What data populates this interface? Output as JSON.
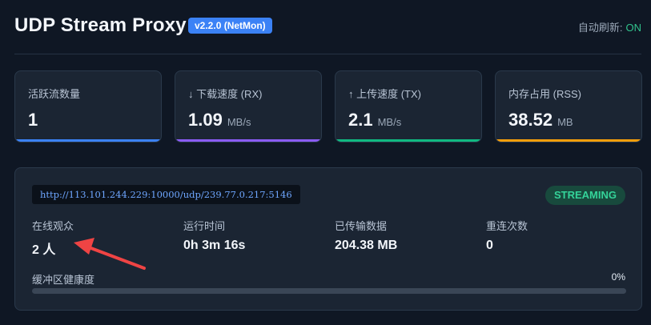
{
  "header": {
    "title": "UDP Stream Proxy",
    "version": "v2.2.0 (NetMon)",
    "auto_refresh_label": "自动刷新:",
    "auto_refresh_value": "ON"
  },
  "metrics": [
    {
      "label": "活跃流数量",
      "value": "1",
      "unit": "",
      "accent_color": "#3b82f6"
    },
    {
      "label": "↓ 下载速度 (RX)",
      "value": "1.09",
      "unit": "MB/s",
      "accent_color": "#8b5cf6"
    },
    {
      "label": "↑ 上传速度 (TX)",
      "value": "2.1",
      "unit": "MB/s",
      "accent_color": "#10b981"
    },
    {
      "label": "内存占用 (RSS)",
      "value": "38.52",
      "unit": "MB",
      "accent_color": "#f59e0b"
    }
  ],
  "stream": {
    "url": "http://113.101.244.229:10000/udp/239.77.0.217:5146",
    "status": "STREAMING",
    "status_color": "#34d399",
    "stats": [
      {
        "label": "在线观众",
        "value": "2 人"
      },
      {
        "label": "运行时间",
        "value": "0h 3m 16s"
      },
      {
        "label": "已传输数据",
        "value": "204.38 MB"
      },
      {
        "label": "重连次数",
        "value": "0"
      }
    ],
    "buffer_label": "缓冲区健康度",
    "buffer_percent_text": "0%",
    "buffer_fraction": 0
  },
  "annotation": {
    "arrow_color": "#ef4444"
  }
}
